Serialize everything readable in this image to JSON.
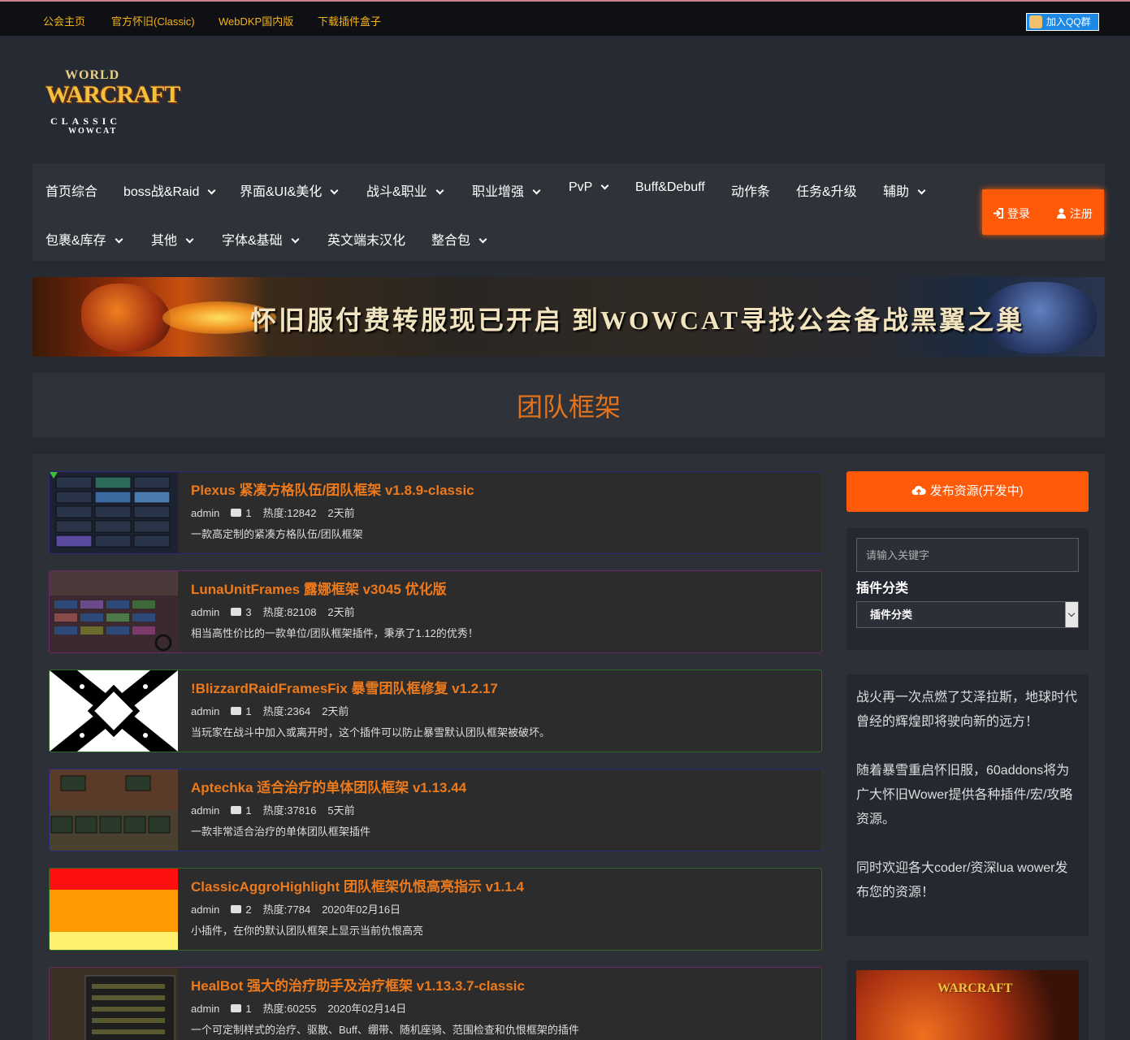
{
  "topbar": {
    "links": [
      "公会主页",
      "官方怀旧(Classic)",
      "WebDKP国内版",
      "下载插件盒子"
    ],
    "qq_label": "加入QQ群"
  },
  "logo": {
    "line1": "WORLD",
    "line2": "WARCRAFT",
    "line3": "CLASSIC",
    "line4": "WOWCAT"
  },
  "nav": {
    "row1": [
      {
        "label": "首页综合",
        "dropdown": false
      },
      {
        "label": "boss战&Raid",
        "dropdown": true
      },
      {
        "label": "界面&UI&美化",
        "dropdown": true
      },
      {
        "label": "战斗&职业",
        "dropdown": true
      },
      {
        "label": "职业增强",
        "dropdown": true
      },
      {
        "label": "PvP",
        "dropdown": true
      },
      {
        "label": "Buff&Debuff",
        "dropdown": false
      },
      {
        "label": "动作条",
        "dropdown": false
      },
      {
        "label": "任务&升级",
        "dropdown": false
      },
      {
        "label": "辅助",
        "dropdown": true
      }
    ],
    "row2": [
      {
        "label": "包裹&库存",
        "dropdown": true
      },
      {
        "label": "其他",
        "dropdown": true
      },
      {
        "label": "字体&基础",
        "dropdown": true
      },
      {
        "label": "英文端末汉化",
        "dropdown": false
      },
      {
        "label": "整合包",
        "dropdown": true
      }
    ],
    "login": "登录",
    "register": "注册"
  },
  "banner": {
    "text": "怀旧服付费转服现已开启 到WOWCAT寻找公会备战黑翼之巢"
  },
  "page_title": "团队框架",
  "posts": [
    {
      "title": "Plexus 紧凑方格队伍/团队框架 v1.8.9-classic",
      "author": "admin",
      "comments": "1",
      "heat": "热度:12842",
      "time": "2天前",
      "desc": "一款高定制的紧凑方格队伍/团队框架",
      "border": "#2a2a7a"
    },
    {
      "title": "LunaUnitFrames 露娜框架 v3045 优化版",
      "author": "admin",
      "comments": "3",
      "heat": "热度:82108",
      "time": "2天前",
      "desc": "相当高性价比的一款单位/团队框架插件，秉承了1.12的优秀！",
      "border": "#6a2a6a"
    },
    {
      "title": "!BlizzardRaidFramesFix 暴雪团队框修复 v1.2.17",
      "author": "admin",
      "comments": "1",
      "heat": "热度:2364",
      "time": "2天前",
      "desc": "当玩家在战斗中加入或离开时，这个插件可以防止暴雪默认团队框架被破坏。",
      "border": "#2a6a2a"
    },
    {
      "title": "Aptechka 适合治疗的单体团队框架 v1.13.44",
      "author": "admin",
      "comments": "1",
      "heat": "热度:37816",
      "time": "5天前",
      "desc": "一款非常适合治疗的单体团队框架插件",
      "border": "#2a2a7a"
    },
    {
      "title": "ClassicAggroHighlight 团队框架仇恨高亮指示 v1.1.4",
      "author": "admin",
      "comments": "2",
      "heat": "热度:7784",
      "time": "2020年02月16日",
      "desc": "小插件，在你的默认团队框架上显示当前仇恨高亮",
      "border": "#2a6a2a"
    },
    {
      "title": "HealBot 强大的治疗助手及治疗框架 v1.13.3.7-classic",
      "author": "admin",
      "comments": "1",
      "heat": "热度:60255",
      "time": "2020年02月14日",
      "desc": "一个可定制样式的治疗、驱散、Buff、绷带、随机座骑、范围检查和仇恨框架的插件",
      "border": "#6a2a6a"
    }
  ],
  "sidebar": {
    "publish_label": "发布资源(开发中)",
    "search_placeholder": "请输入关键字",
    "category_label": "插件分类",
    "category_selected": "插件分类",
    "intro": [
      "战火再一次点燃了艾泽拉斯，地球时代曾经的辉煌即将驶向新的远方！",
      "随着暴雪重启怀旧服，60addons将为广大怀旧Wower提供各种插件/宏/攻略资源。",
      "同时欢迎各大coder/资深lua wower发布您的资源！"
    ]
  },
  "colors": {
    "accent": "#ff5a0a",
    "title_orange": "#e2731c",
    "link_yellow": "#f5b31a"
  }
}
